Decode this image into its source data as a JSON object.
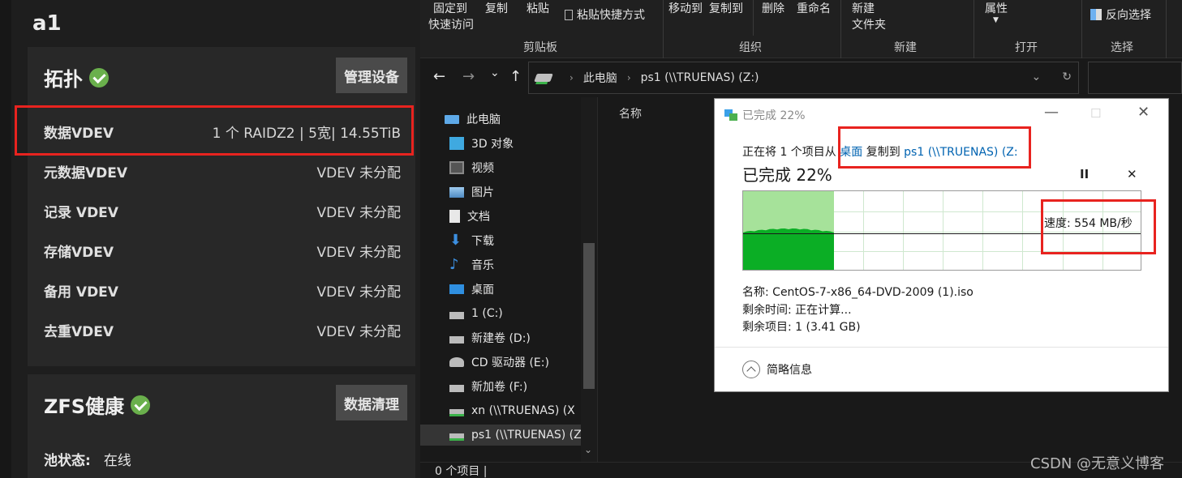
{
  "truenas": {
    "pool_name": "a1",
    "topology": {
      "title": "拓扑",
      "manage_button": "管理设备",
      "rows": [
        {
          "label": "数据VDEV",
          "value": "1 个 RAIDZ2 | 5宽| 14.55TiB"
        },
        {
          "label": "元数据VDEV",
          "value": "VDEV 未分配"
        },
        {
          "label": "记录 VDEV",
          "value": "VDEV 未分配"
        },
        {
          "label": "存储VDEV",
          "value": "VDEV 未分配"
        },
        {
          "label": "备用 VDEV",
          "value": "VDEV 未分配"
        },
        {
          "label": "去重VDEV",
          "value": "VDEV 未分配"
        }
      ]
    },
    "health": {
      "title": "ZFS健康",
      "scrub_button": "数据清理",
      "pool_status_label": "池状态:",
      "pool_status_value": "在线"
    },
    "colors": {
      "highlight": "#e8231f",
      "ok": "#6ab04c"
    }
  },
  "explorer": {
    "ribbon": {
      "pin_line1": "固定到",
      "pin_line2": "快速访问",
      "copy": "复制",
      "paste": "粘贴",
      "paste_shortcut": "粘贴快捷方式",
      "move_to": "移动到",
      "copy_to": "复制到",
      "delete": "删除",
      "rename": "重命名",
      "new_folder_line1": "新建",
      "new_folder_line2": "文件夹",
      "properties": "属性",
      "invert_selection": "反向选择",
      "groups": {
        "clipboard": "剪贴板",
        "organize": "组织",
        "new": "新建",
        "open": "打开",
        "select": "选择"
      }
    },
    "nav": {
      "back": "←",
      "forward": "→",
      "recent": "⌄",
      "up": "↑"
    },
    "address": {
      "root": "此电脑",
      "current": "ps1 (\\\\TRUENAS) (Z:)"
    },
    "tree": [
      {
        "label": "此电脑",
        "icon": "computer-icon"
      },
      {
        "label": "3D 对象",
        "icon": "cube-icon"
      },
      {
        "label": "视频",
        "icon": "video-icon"
      },
      {
        "label": "图片",
        "icon": "picture-icon"
      },
      {
        "label": "文档",
        "icon": "document-icon"
      },
      {
        "label": "下载",
        "icon": "download-icon"
      },
      {
        "label": "音乐",
        "icon": "music-icon"
      },
      {
        "label": "桌面",
        "icon": "desktop-icon"
      },
      {
        "label": "1 (C:)",
        "icon": "drive-icon"
      },
      {
        "label": "新建卷 (D:)",
        "icon": "drive-icon"
      },
      {
        "label": "CD 驱动器 (E:)",
        "icon": "cd-drive-icon"
      },
      {
        "label": "新加卷 (F:)",
        "icon": "drive-icon"
      },
      {
        "label": "xn (\\\\TRUENAS) (X",
        "icon": "network-drive-icon"
      },
      {
        "label": "ps1 (\\\\TRUENAS) (Z",
        "icon": "network-drive-icon"
      }
    ],
    "column_name": "名称",
    "status": "0 个项目  |"
  },
  "dialog": {
    "title": "已完成 22%",
    "line_prefix": "正在将 1 个项目从 ",
    "source": "桌面",
    "line_middle": " 复制到 ",
    "destination": "ps1 (\\\\TRUENAS) (Z:",
    "progress_text": "已完成 22%",
    "progress_fraction": 0.22,
    "speed": "速度: 554 MB/秒",
    "name_label": "名称:",
    "name_value": "CentOS-7-x86_64-DVD-2009 (1).iso",
    "time_label": "剩余时间:",
    "time_value": "正在计算...",
    "items_label": "剩余项目:",
    "items_value": "1 (3.41 GB)",
    "collapse_label": "简略信息",
    "pause": "II",
    "cancel": "✕",
    "colors": {
      "graph_dark": "#0bae25",
      "graph_light": "#a6e29a",
      "link": "#0063b1"
    }
  },
  "watermark": "CSDN @无意义博客"
}
